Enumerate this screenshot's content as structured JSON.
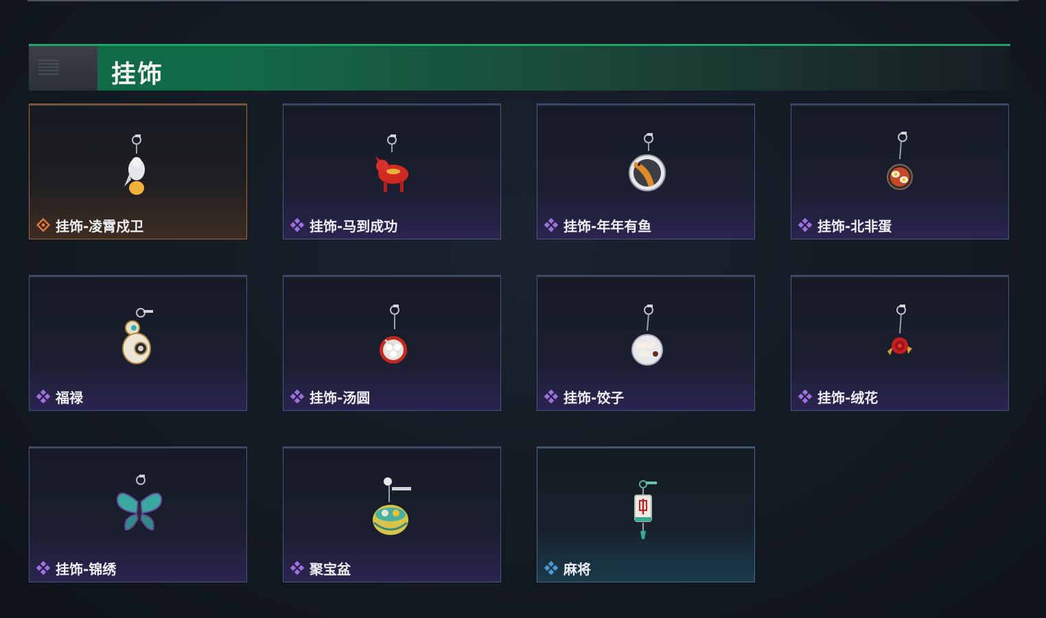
{
  "header": {
    "title": "挂饰"
  },
  "colors": {
    "header_green": "#0f6a45",
    "rarity_gold": "#e0783a",
    "rarity_purple": "#a070e0",
    "rarity_blue": "#4a9ad8"
  },
  "items": [
    {
      "label": "挂饰-凌霄戍卫",
      "rarity": "gold",
      "icon": "guardian-keychain-icon"
    },
    {
      "label": "挂饰-马到成功",
      "rarity": "purple",
      "icon": "red-horse-keychain-icon"
    },
    {
      "label": "挂饰-年年有鱼",
      "rarity": "purple",
      "icon": "fish-plate-keychain-icon"
    },
    {
      "label": "挂饰-北非蛋",
      "rarity": "purple",
      "icon": "shakshuka-keychain-icon"
    },
    {
      "label": "福禄",
      "rarity": "purple",
      "icon": "gourd-keychain-icon"
    },
    {
      "label": "挂饰-汤圆",
      "rarity": "purple",
      "icon": "tangyuan-bowl-keychain-icon"
    },
    {
      "label": "挂饰-饺子",
      "rarity": "purple",
      "icon": "dumpling-plate-keychain-icon"
    },
    {
      "label": "挂饰-绒花",
      "rarity": "purple",
      "icon": "velvet-flower-keychain-icon"
    },
    {
      "label": "挂饰-锦绣",
      "rarity": "purple",
      "icon": "butterfly-keychain-icon"
    },
    {
      "label": "聚宝盆",
      "rarity": "purple",
      "icon": "treasure-bowl-keychain-icon"
    },
    {
      "label": "麻将",
      "rarity": "blue",
      "icon": "mahjong-tile-keychain-icon"
    }
  ]
}
